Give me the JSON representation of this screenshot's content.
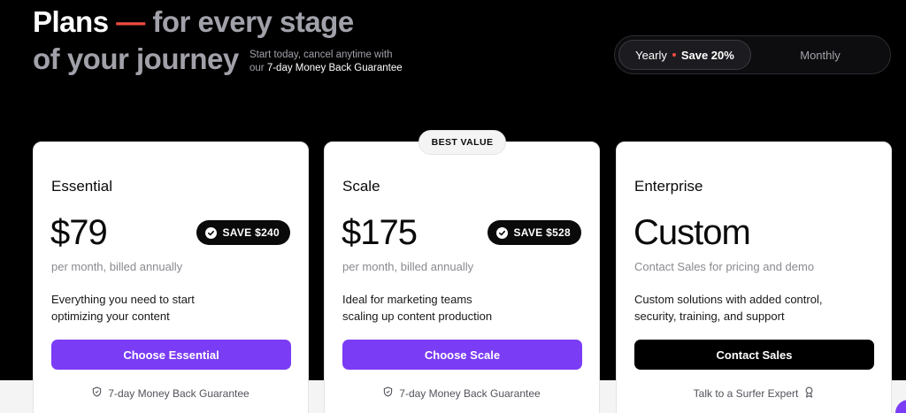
{
  "header": {
    "title_white": "Plans",
    "title_dash": "—",
    "title_grey": "for every stage",
    "title_line2": "of your journey",
    "subtext_line1": "Start today, cancel anytime with",
    "subtext_prefix": "our",
    "subtext_strong": "7-day Money Back Guarantee"
  },
  "billing_toggle": {
    "yearly_label": "Yearly",
    "yearly_save": "Save 20%",
    "monthly_label": "Monthly",
    "selected": "Yearly"
  },
  "badge_best_value": "BEST VALUE",
  "plans": [
    {
      "name": "Essential",
      "price": "$79",
      "save_badge": "SAVE $240",
      "billing_note": "per month, billed annually",
      "description_line1": "Everything you need to start",
      "description_line2": "optimizing your content",
      "cta": "Choose Essential",
      "footer": "7-day Money Back Guarantee",
      "footer_icon": "shield-icon"
    },
    {
      "name": "Scale",
      "price": "$175",
      "save_badge": "SAVE $528",
      "billing_note": "per month, billed annually",
      "description_line1": "Ideal for marketing teams",
      "description_line2": "scaling up content production",
      "cta": "Choose Scale",
      "footer": "7-day Money Back Guarantee",
      "footer_icon": "shield-icon"
    },
    {
      "name": "Enterprise",
      "price": "Custom",
      "billing_note": "Contact Sales for pricing and demo",
      "description_line1": "Custom solutions with added control,",
      "description_line2": "security, training, and support",
      "cta": "Contact Sales",
      "footer": "Talk to a Surfer Expert",
      "footer_icon": "award-icon"
    }
  ],
  "colors": {
    "accent_purple": "#7a3cf5",
    "accent_red": "#ef4b3f",
    "background": "#000000",
    "card": "#ffffff"
  }
}
